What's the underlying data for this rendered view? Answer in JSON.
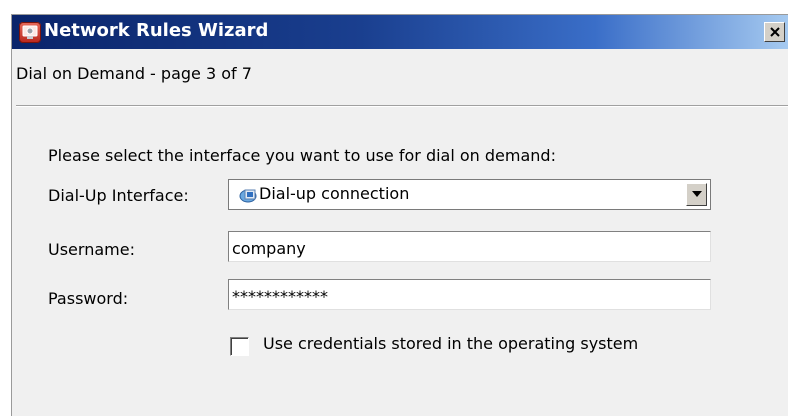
{
  "window": {
    "title": "Network Rules Wizard",
    "app_icon": "wizard-app-icon",
    "close_icon": "close-icon"
  },
  "header": {
    "page_title": "Dial on Demand - page 3 of 7"
  },
  "form": {
    "instruction": "Please select the interface you want to use for dial on demand:",
    "dialup": {
      "label": "Dial-Up Interface:",
      "value": "Dial-up connection",
      "icon": "dialup-connection-icon"
    },
    "username": {
      "label": "Username:",
      "value": "company"
    },
    "password": {
      "label": "Password:",
      "value": "************"
    },
    "use_credentials": {
      "label": "Use credentials stored in the operating system",
      "checked": false
    }
  }
}
